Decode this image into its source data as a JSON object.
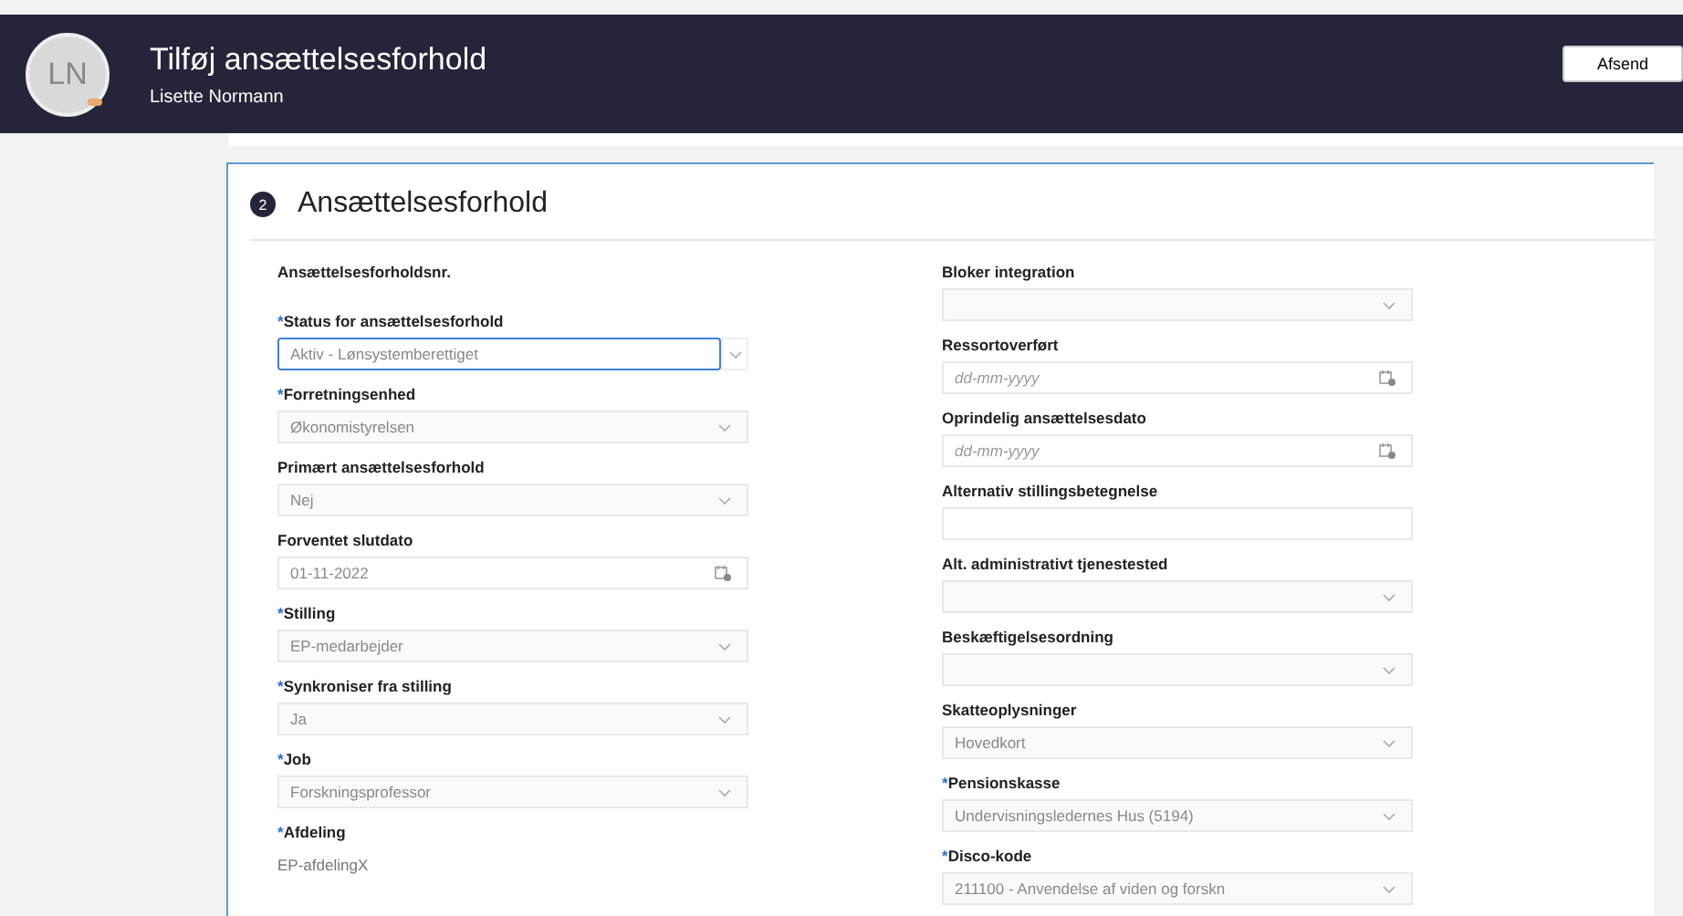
{
  "header": {
    "avatar": "LN",
    "title": "Tilføj ansættelsesforhold",
    "subtitle": "Lisette Normann",
    "button": "Afsend"
  },
  "section": {
    "step": "2",
    "title": "Ansættelsesforhold"
  },
  "required_marker": "*",
  "left_fields": [
    {
      "kind": "static",
      "label": "Ansættelsesforholdsnr.",
      "required": false
    },
    {
      "kind": "select",
      "label": "Status for ansættelsesforhold",
      "required": true,
      "focused": true,
      "value": "Aktiv - Lønsystemberettiget"
    },
    {
      "kind": "select",
      "label": "Forretningsenhed",
      "required": true,
      "focused": false,
      "value": "Økonomistyrelsen"
    },
    {
      "kind": "select",
      "label": "Primært ansættelsesforhold",
      "required": false,
      "focused": false,
      "value": "Nej"
    },
    {
      "kind": "date",
      "label": "Forventet slutdato",
      "required": false,
      "value": "01-11-2022"
    },
    {
      "kind": "select",
      "label": "Stilling",
      "required": true,
      "focused": false,
      "value": "EP-medarbejder"
    },
    {
      "kind": "select",
      "label": "Synkroniser fra stilling",
      "required": true,
      "focused": false,
      "value": "Ja"
    },
    {
      "kind": "select",
      "label": "Job",
      "required": true,
      "focused": false,
      "value": "Forskningsprofessor"
    },
    {
      "kind": "static",
      "label": "Afdeling",
      "required": true,
      "value": "EP-afdelingX"
    }
  ],
  "right_fields": [
    {
      "kind": "select",
      "label": "Bloker integration",
      "required": false,
      "focused": false
    },
    {
      "kind": "date",
      "label": "Ressortoverført",
      "required": false,
      "placeholder": "dd-mm-yyyy"
    },
    {
      "kind": "date",
      "label": "Oprindelig ansættelsesdato",
      "required": false,
      "placeholder": "dd-mm-yyyy"
    },
    {
      "kind": "text",
      "label": "Alternativ stillingsbetegnelse",
      "required": false
    },
    {
      "kind": "select",
      "label": "Alt. administrativt tjenestested",
      "required": false,
      "focused": false
    },
    {
      "kind": "select",
      "label": "Beskæftigelsesordning",
      "required": false,
      "focused": false
    },
    {
      "kind": "select",
      "label": "Skatteoplysninger",
      "required": false,
      "focused": false,
      "value": "Hovedkort"
    },
    {
      "kind": "select",
      "label": "Pensionskasse",
      "required": true,
      "focused": false,
      "value": "Undervisningsledernes Hus (5194)"
    },
    {
      "kind": "select",
      "label": "Disco-kode",
      "required": true,
      "focused": false,
      "value": "211100 - Anvendelse af viden og forskn"
    }
  ]
}
